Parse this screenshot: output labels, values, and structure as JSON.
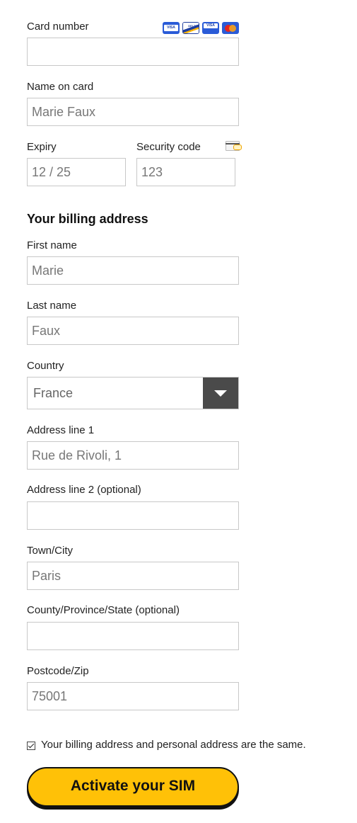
{
  "card_section": {
    "card_number_label": "Card number",
    "card_number_value": "",
    "name_on_card_label": "Name on card",
    "name_on_card_value": "Marie Faux",
    "expiry_label": "Expiry",
    "expiry_value": "12 / 25",
    "security_code_label": "Security code",
    "security_code_value": "123",
    "card_logos": [
      {
        "icon": "visa-icon",
        "text": "VISA",
        "color": "#2a5bd7"
      },
      {
        "icon": "delta-icon",
        "text": "DELTA",
        "color": "#1f3f9f"
      },
      {
        "icon": "visa-electron-icon",
        "text": "VISA",
        "color": "#2a5bd7"
      },
      {
        "icon": "mastercard-icon",
        "text": "MC",
        "color": "#2a5bd7"
      }
    ]
  },
  "billing": {
    "title": "Your billing address",
    "first_name_label": "First name",
    "first_name_value": "Marie",
    "last_name_label": "Last name",
    "last_name_value": "Faux",
    "country_label": "Country",
    "country_value": "France",
    "address1_label": "Address line 1",
    "address1_value": "Rue de Rivoli, 1",
    "address2_label": "Address line 2 (optional)",
    "address2_value": "",
    "town_label": "Town/City",
    "town_value": "Paris",
    "county_label": "County/Province/State (optional)",
    "county_value": "",
    "postcode_label": "Postcode/Zip",
    "postcode_value": "75001"
  },
  "agreement": {
    "checked": true,
    "text": "Your billing address and personal address are the same."
  },
  "cta": {
    "label": "Activate your SIM",
    "color": "#ffc107"
  }
}
